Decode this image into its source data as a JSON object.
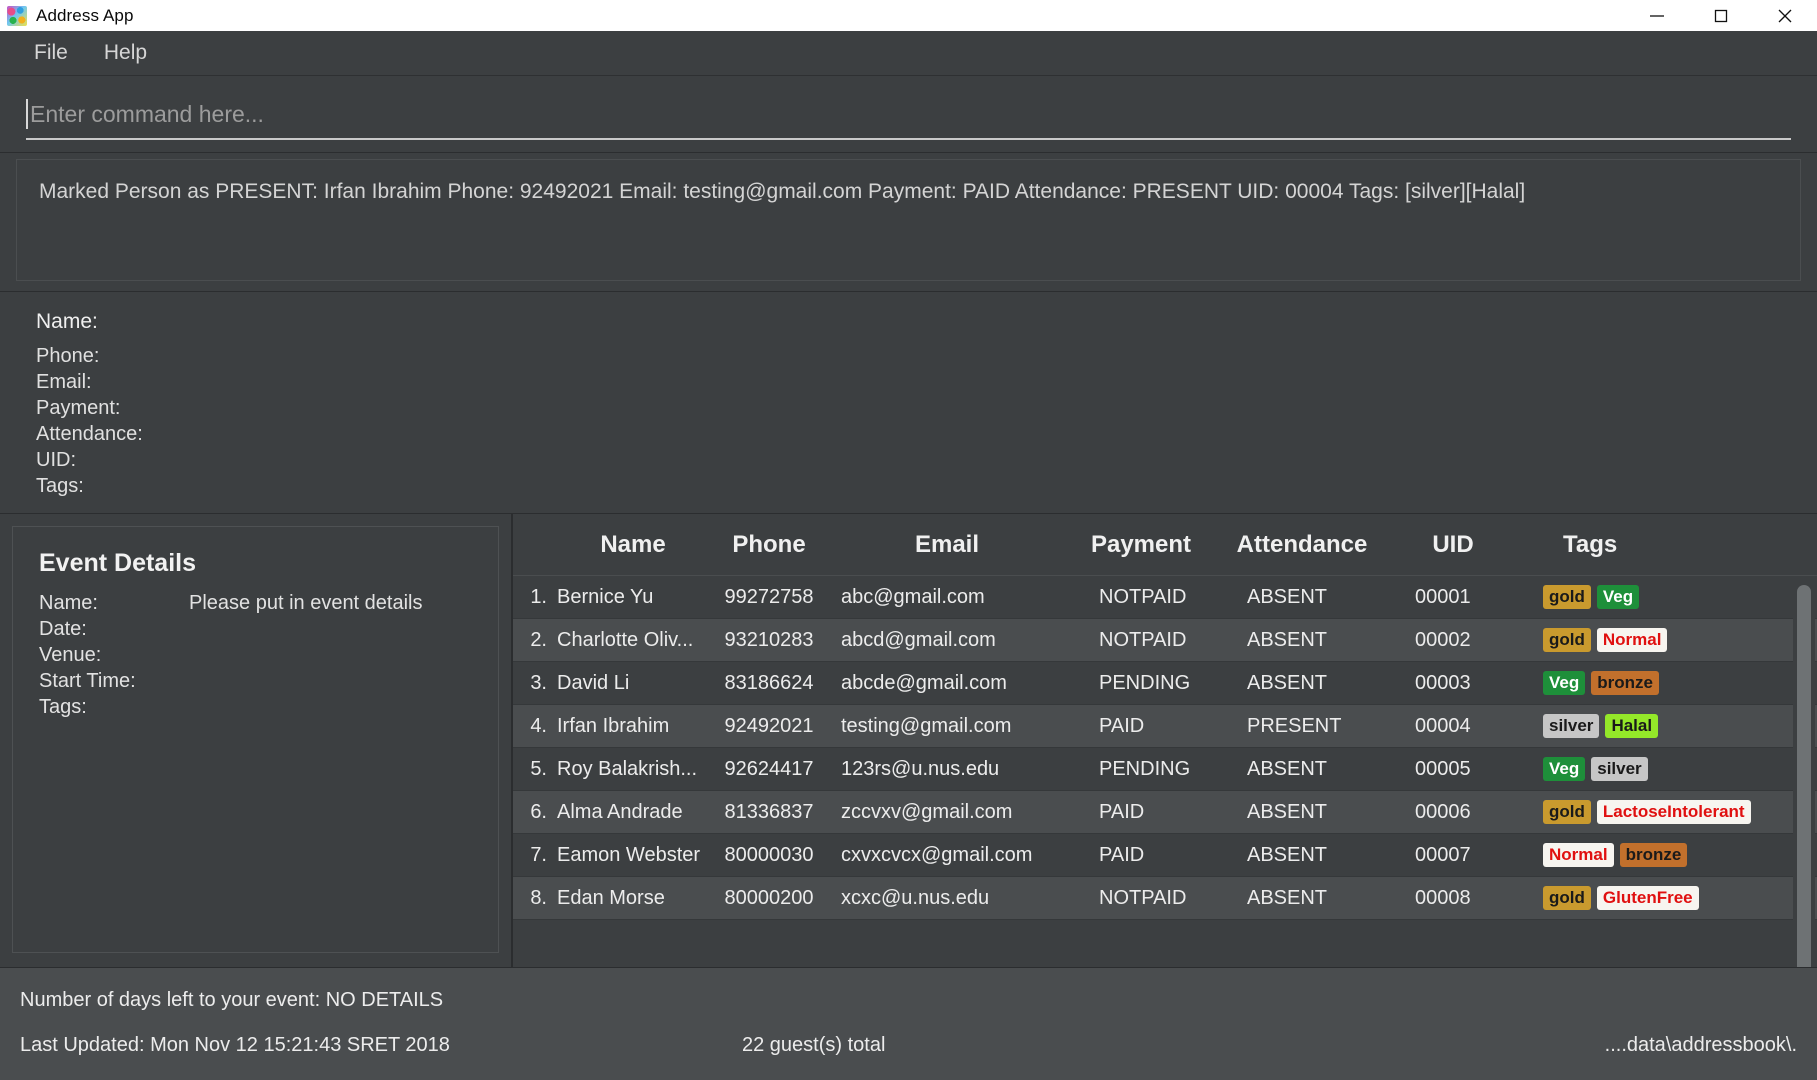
{
  "window": {
    "title": "Address App",
    "icon": "app-logo-icon",
    "controls": [
      {
        "name": "minimize",
        "glyph": "minimize-icon"
      },
      {
        "name": "maximize",
        "glyph": "maximize-icon"
      },
      {
        "name": "close",
        "glyph": "close-icon"
      }
    ]
  },
  "menubar": {
    "items": [
      {
        "label": "File"
      },
      {
        "label": "Help"
      }
    ]
  },
  "command": {
    "placeholder": "Enter command here...",
    "value": ""
  },
  "result": {
    "text": "Marked Person as PRESENT: Irfan Ibrahim Phone: 92492021 Email: testing@gmail.com Payment: PAID Attendance: PRESENT UID: 00004 Tags: [silver][Halal]"
  },
  "person": {
    "name_label": "Name:",
    "name_value": "",
    "fields": [
      {
        "label": "Phone:",
        "value": ""
      },
      {
        "label": "Email:",
        "value": ""
      },
      {
        "label": "Payment:",
        "value": ""
      },
      {
        "label": "Attendance:",
        "value": ""
      },
      {
        "label": "UID:",
        "value": ""
      },
      {
        "label": "Tags:",
        "value": ""
      }
    ]
  },
  "event": {
    "title": "Event Details",
    "rows": [
      {
        "label": "Name:",
        "value": "Please put in event details"
      },
      {
        "label": "Date:",
        "value": ""
      },
      {
        "label": "Venue:",
        "value": ""
      },
      {
        "label": "Start Time:",
        "value": ""
      },
      {
        "label": "Tags:",
        "value": ""
      }
    ]
  },
  "table": {
    "headers": {
      "index": "",
      "name": "Name",
      "phone": "Phone",
      "email": "Email",
      "payment": "Payment",
      "attendance": "Attendance",
      "uid": "UID",
      "tags": "Tags"
    },
    "rows": [
      {
        "index": "1.",
        "name": "Bernice Yu",
        "phone": "99272758",
        "email": "abc@gmail.com",
        "payment": "NOTPAID",
        "attendance": "ABSENT",
        "uid": "00001",
        "tags": [
          {
            "label": "gold",
            "bg": "#c99a2e",
            "fg": "#1a1a1a"
          },
          {
            "label": "Veg",
            "bg": "#1e8f3a",
            "fg": "#ffffff"
          }
        ]
      },
      {
        "index": "2.",
        "name": "Charlotte Oliv...",
        "phone": "93210283",
        "email": "abcd@gmail.com",
        "payment": "NOTPAID",
        "attendance": "ABSENT",
        "uid": "00002",
        "tags": [
          {
            "label": "gold",
            "bg": "#c99a2e",
            "fg": "#1a1a1a"
          },
          {
            "label": "Normal",
            "bg": "#f7f5f0",
            "fg": "#e01010"
          }
        ]
      },
      {
        "index": "3.",
        "name": "David Li",
        "phone": "83186624",
        "email": "abcde@gmail.com",
        "payment": "PENDING",
        "attendance": "ABSENT",
        "uid": "00003",
        "tags": [
          {
            "label": "Veg",
            "bg": "#1e8f3a",
            "fg": "#ffffff"
          },
          {
            "label": "bronze",
            "bg": "#c2702c",
            "fg": "#1a1a1a"
          }
        ]
      },
      {
        "index": "4.",
        "name": "Irfan Ibrahim",
        "phone": "92492021",
        "email": "testing@gmail.com",
        "payment": "PAID",
        "attendance": "PRESENT",
        "uid": "00004",
        "tags": [
          {
            "label": "silver",
            "bg": "#c6c6c6",
            "fg": "#1a1a1a"
          },
          {
            "label": "Halal",
            "bg": "#94e829",
            "fg": "#1a1a1a"
          }
        ]
      },
      {
        "index": "5.",
        "name": "Roy Balakrish...",
        "phone": "92624417",
        "email": "123rs@u.nus.edu",
        "payment": "PENDING",
        "attendance": "ABSENT",
        "uid": "00005",
        "tags": [
          {
            "label": "Veg",
            "bg": "#1e8f3a",
            "fg": "#ffffff"
          },
          {
            "label": "silver",
            "bg": "#c6c6c6",
            "fg": "#1a1a1a"
          }
        ]
      },
      {
        "index": "6.",
        "name": "Alma Andrade",
        "phone": "81336837",
        "email": "zccvxv@gmail.com",
        "payment": "PAID",
        "attendance": "ABSENT",
        "uid": "00006",
        "tags": [
          {
            "label": "gold",
            "bg": "#c99a2e",
            "fg": "#1a1a1a"
          },
          {
            "label": "LactoseIntolerant",
            "bg": "#f7f5f0",
            "fg": "#e01010"
          }
        ]
      },
      {
        "index": "7.",
        "name": "Eamon Webster",
        "phone": "80000030",
        "email": "cxvxcvcx@gmail.com",
        "payment": "PAID",
        "attendance": "ABSENT",
        "uid": "00007",
        "tags": [
          {
            "label": "Normal",
            "bg": "#f7f5f0",
            "fg": "#e01010"
          },
          {
            "label": "bronze",
            "bg": "#c2702c",
            "fg": "#1a1a1a"
          }
        ]
      },
      {
        "index": "8.",
        "name": "Edan Morse",
        "phone": "80000200",
        "email": "xcxc@u.nus.edu",
        "payment": "NOTPAID",
        "attendance": "ABSENT",
        "uid": "00008",
        "tags": [
          {
            "label": "gold",
            "bg": "#c99a2e",
            "fg": "#1a1a1a"
          },
          {
            "label": "GlutenFree",
            "bg": "#f7f5f0",
            "fg": "#e01010"
          }
        ]
      }
    ]
  },
  "statusbar": {
    "days_left": "Number of days left to your event: NO DETAILS",
    "last_updated": "Last Updated: Mon Nov 12 15:21:43 SRET 2018",
    "guest_total": "22 guest(s) total",
    "save_location": "....data\\addressbook\\."
  }
}
